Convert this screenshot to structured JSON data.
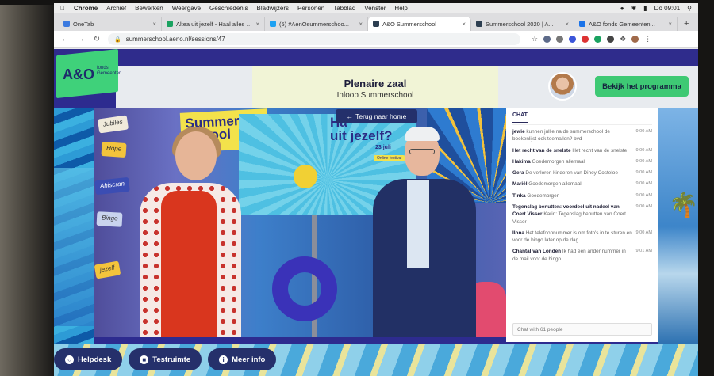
{
  "menubar": {
    "app_name": "Chrome",
    "items": [
      "Archief",
      "Bewerken",
      "Weergave",
      "Geschiedenis",
      "Bladwijzers",
      "Personen",
      "Tabblad",
      "Venster",
      "Help"
    ],
    "clock": "Do 09:01"
  },
  "tabs": [
    {
      "label": "OneTab",
      "color": "#3b7ae0"
    },
    {
      "label": "Altea uit jezelf - Haal alles uit...",
      "color": "#1aa260"
    },
    {
      "label": "(5) #AenOsummerschoo...",
      "color": "#1da1f2"
    },
    {
      "label": "A&O Summerschool",
      "color": "#2c3e50",
      "active": true
    },
    {
      "label": "Summerschool 2020 | A...",
      "color": "#2c3e50"
    },
    {
      "label": "A&O fonds Gemeenten...",
      "color": "#1a73e8"
    }
  ],
  "toolbar": {
    "url": "summerschool.aeno.nl/sessions/47"
  },
  "logo": {
    "mark": "A&O",
    "sub_line1": "fonds",
    "sub_line2": "Gemeenten"
  },
  "header": {
    "title": "Plenaire zaal",
    "subtitle": "Inloop Summerschool",
    "program_button": "Bekijk het programma"
  },
  "video": {
    "back_button": "Terug naar home",
    "logo_text_line1": "Summer",
    "logo_text_line2": "School",
    "heading_line1": "Ha",
    "heading_line2": "uit jezelf?",
    "date": "23 juli",
    "badge": "Online festival",
    "signs": [
      "Jubiles",
      "Hope",
      "Ahiscran",
      "Bingo",
      "jezelf"
    ]
  },
  "chat": {
    "tab_label": "CHAT",
    "input_placeholder": "Chat with 61 people",
    "messages": [
      {
        "name": "jewie",
        "text": "kunnen jullie na de summerschool de boekenlijst ook toemailen? bvd",
        "time": "9:00 AM"
      },
      {
        "name": "Het recht van de snelste",
        "text": "Het recht van de snelste",
        "time": "9:00 AM"
      },
      {
        "name": "Hakima",
        "text": "Goedemorgen allemaal",
        "time": "9:00 AM"
      },
      {
        "name": "Gera",
        "text": "De verloren kinderen van Diney Costeloe",
        "time": "9:00 AM"
      },
      {
        "name": "Mariël",
        "text": "Goedemorgen allemaal",
        "time": "9:00 AM"
      },
      {
        "name": "Tinka",
        "text": "Goedemorgen",
        "time": "9:00 AM"
      },
      {
        "name": "Tegenslag benutten: voordeel uit nadeel van Coert Visser",
        "text": "Karin: Tegenslag benutten van Coert Visser",
        "time": "9:00 AM"
      },
      {
        "name": "Ilona",
        "text": "Het telefoonnummer is om foto's in te sturen en voor de bingo later op de dag",
        "time": "9:00 AM"
      },
      {
        "name": "Chantal van Londen",
        "text": "Ik had een ander nummer in de mail voor de bingo.",
        "time": "9:01 AM"
      }
    ]
  },
  "bottom": {
    "helpdesk": "Helpdesk",
    "testruimte": "Testruimte",
    "meer_info": "Meer info"
  }
}
